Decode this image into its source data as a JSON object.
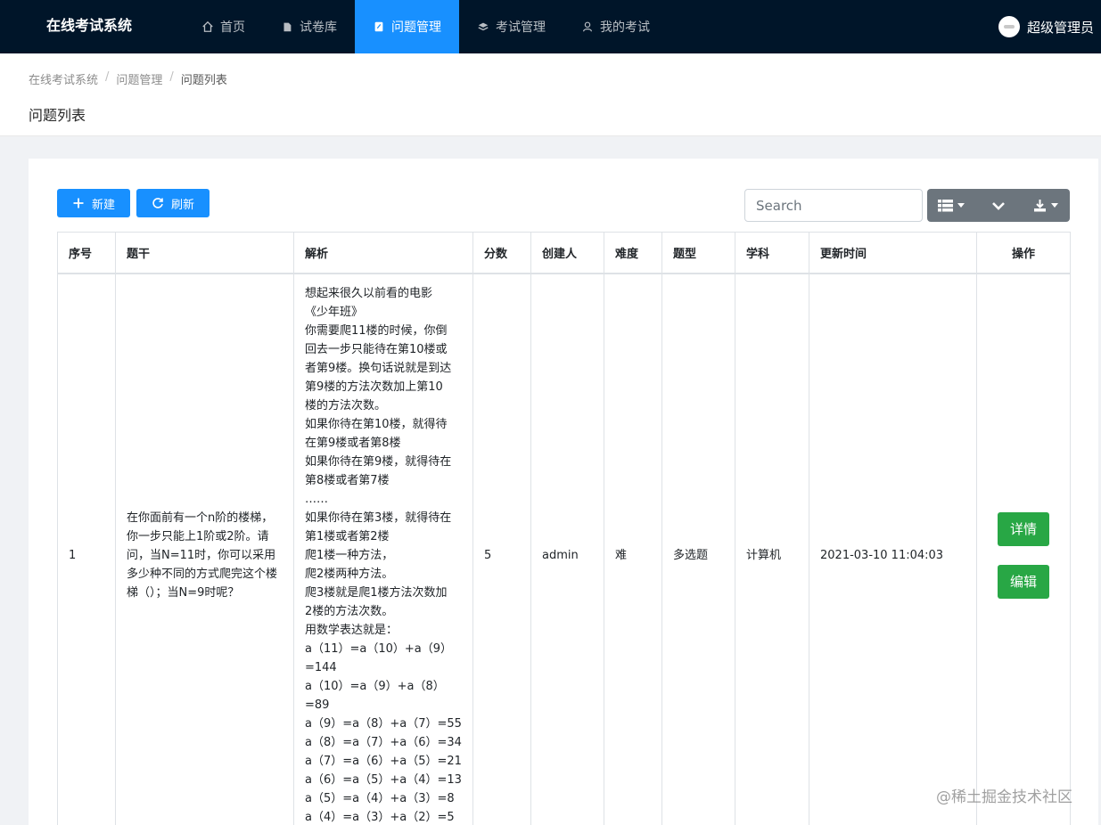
{
  "app": {
    "title": "在线考试系统"
  },
  "nav": [
    {
      "label": "首页",
      "icon": "home-icon",
      "active": false
    },
    {
      "label": "试卷库",
      "icon": "paper-icon",
      "active": false
    },
    {
      "label": "问题管理",
      "icon": "edit-icon",
      "active": true
    },
    {
      "label": "考试管理",
      "icon": "stack-icon",
      "active": false
    },
    {
      "label": "我的考试",
      "icon": "user-icon",
      "active": false
    }
  ],
  "user": {
    "name": "超级管理员"
  },
  "breadcrumb": [
    "在线考试系统",
    "问题管理",
    "问题列表"
  ],
  "page_title": "问题列表",
  "toolbar": {
    "new_label": "新建",
    "refresh_label": "刷新",
    "search_placeholder": "Search"
  },
  "table": {
    "headers": [
      "序号",
      "题干",
      "解析",
      "分数",
      "创建人",
      "难度",
      "题型",
      "学科",
      "更新时间",
      "操作"
    ],
    "rows": [
      {
        "index": "1",
        "stem": "在你面前有一个n阶的楼梯，你一步只能上1阶或2阶。请问，当N=11时，你可以采用多少种不同的方式爬完这个楼梯（）；当N=9时呢？",
        "analysis_lines": [
          "想起来很久以前看的电影",
          "《少年班》",
          "你需要爬11楼的时候，你倒",
          "回去一步只能待在第10楼或",
          "者第9楼。换句话说就是到达",
          "第9楼的方法次数加上第10",
          "楼的方法次数。",
          "如果你待在第10楼，就得待",
          "在第9楼或者第8楼",
          "如果你待在第9楼，就得待在",
          "第8楼或者第7楼",
          "……",
          "如果你待在第3楼，就得待在",
          "第1楼或者第2楼",
          "爬1楼一种方法，",
          "爬2楼两种方法。",
          "爬3楼就是爬1楼方法次数加",
          "2楼的方法次数。",
          "用数学表达就是：",
          "a（11）=a（10）+a（9）",
          "=144",
          "a（10）=a（9）+a（8）",
          "=89",
          "a（9）=a（8）+a（7）=55",
          "a（8）=a（7）+a（6）=34",
          "a（7）=a（6）+a（5）=21",
          "a（6）=a（5）+a（4）=13",
          "a（5）=a（4）+a（3）=8",
          "a（4）=a（3）+a（2）=5"
        ],
        "score": "5",
        "creator": "admin",
        "difficulty": "难",
        "type": "多选题",
        "subject": "计算机",
        "updated": "2021-03-10 11:04:03",
        "detail_label": "详情",
        "edit_label": "编辑"
      }
    ]
  },
  "watermark": "@稀土掘金技术社区",
  "colors": {
    "topbar": "#001529",
    "active_nav": "#1890ff",
    "primary_button": "#1890ff",
    "success_button": "#28a745",
    "toolbar_group": "#6c757d"
  }
}
